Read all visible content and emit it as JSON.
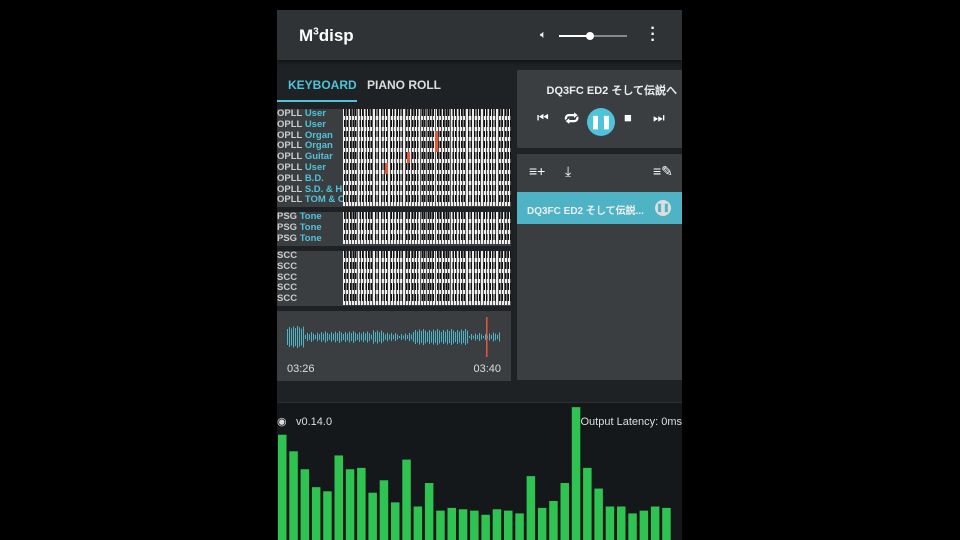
{
  "app": {
    "title": "M",
    "title_sup": "3",
    "title_rest": "disp",
    "volume": 0.45
  },
  "tabs": [
    {
      "label": "KEYBOARD",
      "active": true
    },
    {
      "label": "PIANO ROLL",
      "active": false
    }
  ],
  "channels": {
    "opll": [
      {
        "type": "OPLL",
        "name": "User"
      },
      {
        "type": "OPLL",
        "name": "User"
      },
      {
        "type": "OPLL",
        "name": "Organ"
      },
      {
        "type": "OPLL",
        "name": "Organ"
      },
      {
        "type": "OPLL",
        "name": "Guitar"
      },
      {
        "type": "OPLL",
        "name": "User"
      },
      {
        "type": "OPLL",
        "name": "B.D."
      },
      {
        "type": "OPLL",
        "name": "S.D. & HH"
      },
      {
        "type": "OPLL",
        "name": "TOM & CYM"
      }
    ],
    "psg": [
      {
        "type": "PSG",
        "name": "Tone"
      },
      {
        "type": "PSG",
        "name": "Tone"
      },
      {
        "type": "PSG",
        "name": "Tone"
      }
    ],
    "scc": [
      {
        "type": "SCC",
        "name": ""
      },
      {
        "type": "SCC",
        "name": ""
      },
      {
        "type": "SCC",
        "name": ""
      },
      {
        "type": "SCC",
        "name": ""
      },
      {
        "type": "SCC",
        "name": ""
      }
    ]
  },
  "active_notes": {
    "opll": [
      [],
      [],
      [
        0.55
      ],
      [
        0.55
      ],
      [
        0.38
      ],
      [
        0.25
      ],
      [],
      [],
      []
    ]
  },
  "waveform": {
    "elapsed": "03:26",
    "total": "03:40",
    "progress": 0.93
  },
  "player": {
    "now_playing": "DQ3FC ED2 そして伝説へ"
  },
  "playlist": {
    "items": [
      {
        "title": "DQ3FC ED2 そして伝説...",
        "playing": true
      }
    ]
  },
  "footer": {
    "version": "v0.14.0",
    "latency": "Output Latency: 0ms"
  },
  "spectrum": {
    "levels": [
      77,
      65,
      52,
      39,
      36,
      62,
      52,
      53,
      35,
      44,
      28,
      59,
      25,
      42,
      22,
      24,
      23,
      22,
      19,
      23,
      22,
      20,
      47,
      24,
      29,
      42,
      97,
      53,
      38,
      25,
      25,
      20,
      22,
      25,
      24
    ],
    "color": "#2fc451"
  },
  "colors": {
    "accent": "#4fc3d9",
    "note": "#e05a3a"
  }
}
